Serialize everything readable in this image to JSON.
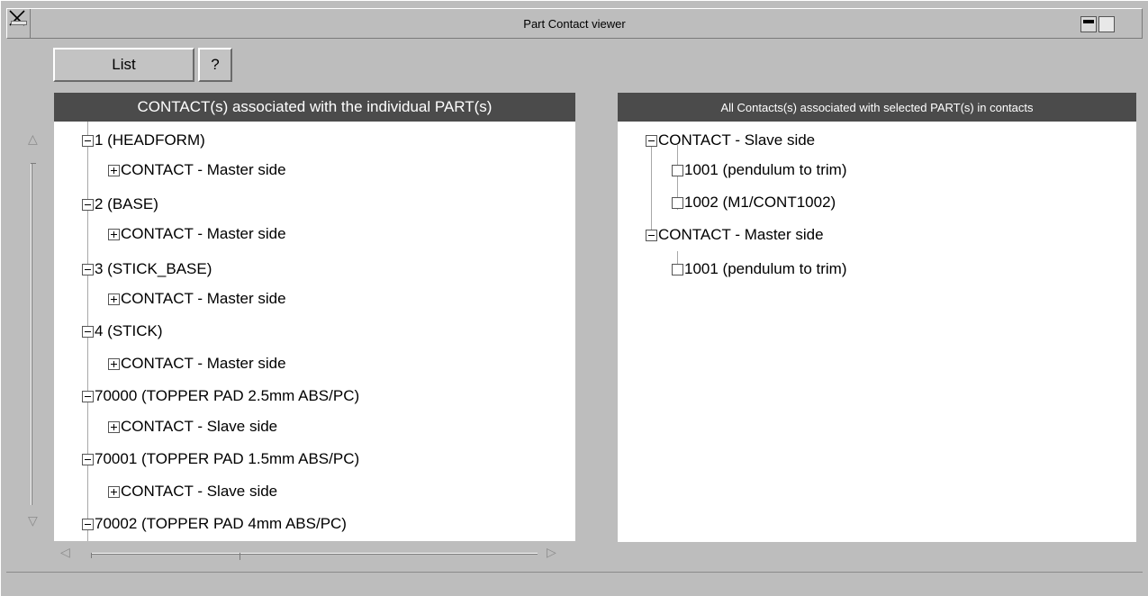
{
  "window": {
    "title": "Part Contact viewer",
    "close_glyph": "X"
  },
  "toolbar": {
    "list_label": "List",
    "help_label": "?"
  },
  "left_panel": {
    "header": "CONTACT(s) associated with the individual PART(s)",
    "parts": [
      {
        "label": "1 (HEADFORM)",
        "child": "CONTACT - Master side"
      },
      {
        "label": "2 (BASE)",
        "child": "CONTACT - Master side"
      },
      {
        "label": "3 (STICK_BASE)",
        "child": "CONTACT - Master side"
      },
      {
        "label": "4 (STICK)",
        "child": "CONTACT - Master side"
      },
      {
        "label": "70000 (TOPPER PAD 2.5mm ABS/PC)",
        "child": "CONTACT - Slave side"
      },
      {
        "label": "70001 (TOPPER PAD 1.5mm ABS/PC)",
        "child": "CONTACT - Slave side"
      },
      {
        "label": "70002 (TOPPER PAD 4mm  ABS/PC)",
        "child": ""
      }
    ]
  },
  "right_panel": {
    "header": "All Contacts(s) associated with selected PART(s) in contacts",
    "groups": [
      {
        "label": "CONTACT - Slave  side",
        "items": [
          "1001 (pendulum to trim)",
          "1002 (M1/CONT1002)"
        ]
      },
      {
        "label": "CONTACT - Master side",
        "items": [
          "1001 (pendulum to trim)"
        ]
      }
    ]
  },
  "icons": {
    "scroll_up": "up-arrow-icon",
    "scroll_down": "down-arrow-icon",
    "scroll_left": "left-arrow-icon",
    "scroll_right": "right-arrow-icon"
  }
}
